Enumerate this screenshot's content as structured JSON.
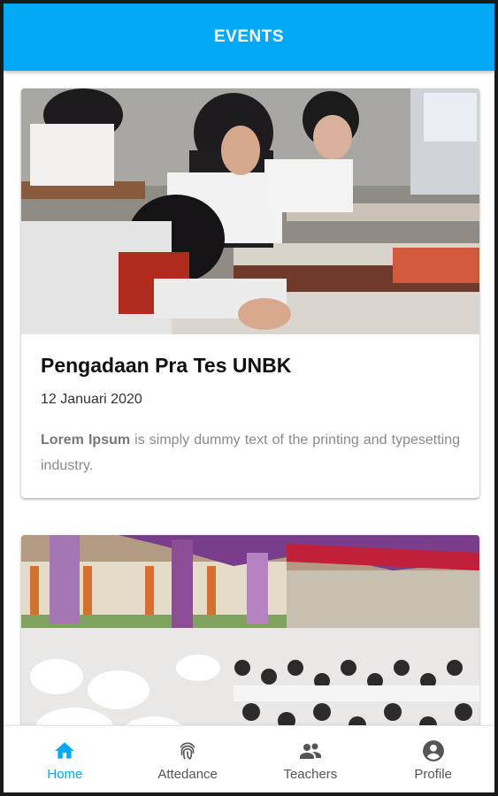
{
  "appbar": {
    "title": "EVENTS"
  },
  "events": [
    {
      "title": "Pengadaan Pra Tes UNBK",
      "date": "12 Januari 2020",
      "desc_bold": "Lorem Ipsum",
      "desc_rest": " is simply dummy text of the printing and typesetting industry."
    }
  ],
  "bottom_nav": {
    "items": [
      {
        "label": "Home",
        "icon": "home-icon",
        "active": true
      },
      {
        "label": "Attedance",
        "icon": "fingerprint-icon",
        "active": false
      },
      {
        "label": "Teachers",
        "icon": "people-icon",
        "active": false
      },
      {
        "label": "Profile",
        "icon": "account-circle-icon",
        "active": false
      }
    ]
  },
  "colors": {
    "primary": "#03a9f4",
    "inactive": "#555555"
  }
}
